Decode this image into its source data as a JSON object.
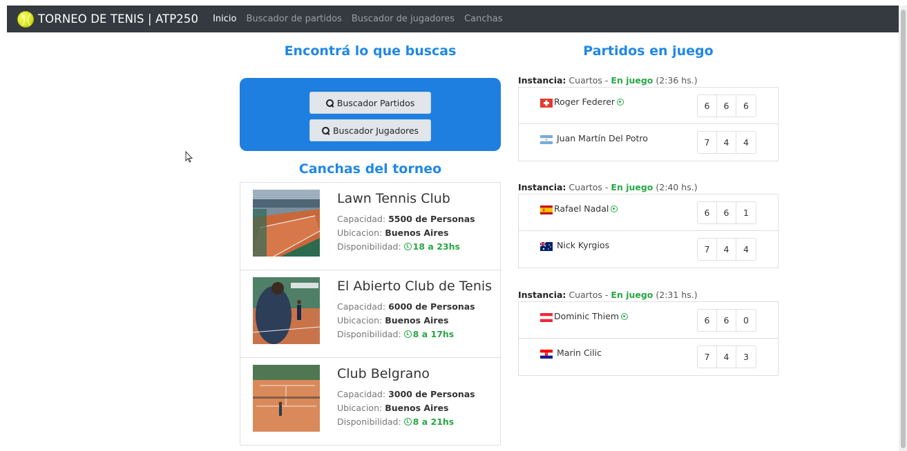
{
  "navbar": {
    "brand": "TORNEO DE TENIS | ATP250",
    "links": [
      "Inicio",
      "Buscador de partidos",
      "Buscador de jugadores",
      "Canchas"
    ],
    "active_index": 0
  },
  "search": {
    "title": "Encontrá lo que buscas",
    "buttons": [
      "Buscador Partidos",
      "Buscador Jugadores"
    ]
  },
  "courts": {
    "title": "Canchas del torneo",
    "labels": {
      "capacity": "Capacidad:",
      "location": "Ubicacion:",
      "availability": "Disponibilidad:"
    },
    "items": [
      {
        "name": "Lawn Tennis Club",
        "capacity": "5500 de Personas",
        "location": "Buenos Aires",
        "hours": "18 a 23hs"
      },
      {
        "name": "El Abierto Club de Tenis",
        "capacity": "6000 de Personas",
        "location": "Buenos Aires",
        "hours": "8 a 17hs"
      },
      {
        "name": "Club Belgrano",
        "capacity": "3000 de Personas",
        "location": "Buenos Aires",
        "hours": "8 a 21hs"
      }
    ]
  },
  "matches": {
    "title": "Partidos en juego",
    "labels": {
      "instance": "Instancia:",
      "live": "En juego"
    },
    "items": [
      {
        "stage": "Cuartos",
        "time": "(2:36 hs.)",
        "p1": {
          "name": "Roger Federer",
          "flag": "switzerland-flag-icon",
          "scores": [
            "6",
            "6",
            "6"
          ],
          "serving": true
        },
        "p2": {
          "name": "Juan Martín Del Potro",
          "flag": "argentina-flag-icon",
          "scores": [
            "7",
            "4",
            "4"
          ],
          "serving": false
        }
      },
      {
        "stage": "Cuartos",
        "time": "(2:40 hs.)",
        "p1": {
          "name": "Rafael Nadal",
          "flag": "spain-flag-icon",
          "scores": [
            "6",
            "6",
            "1"
          ],
          "serving": true
        },
        "p2": {
          "name": "Nick Kyrgios",
          "flag": "australia-flag-icon",
          "scores": [
            "7",
            "4",
            "4"
          ],
          "serving": false
        }
      },
      {
        "stage": "Cuartos",
        "time": "(2:31 hs.)",
        "p1": {
          "name": "Dominic Thiem",
          "flag": "austria-flag-icon",
          "scores": [
            "6",
            "6",
            "0"
          ],
          "serving": true
        },
        "p2": {
          "name": "Marin Cilic",
          "flag": "croatia-flag-icon",
          "scores": [
            "7",
            "4",
            "3"
          ],
          "serving": false
        }
      }
    ]
  },
  "colors": {
    "navbar": "#343a40",
    "accent": "#1f88e5",
    "panel": "#1e7fe0",
    "live": "#28a745"
  }
}
